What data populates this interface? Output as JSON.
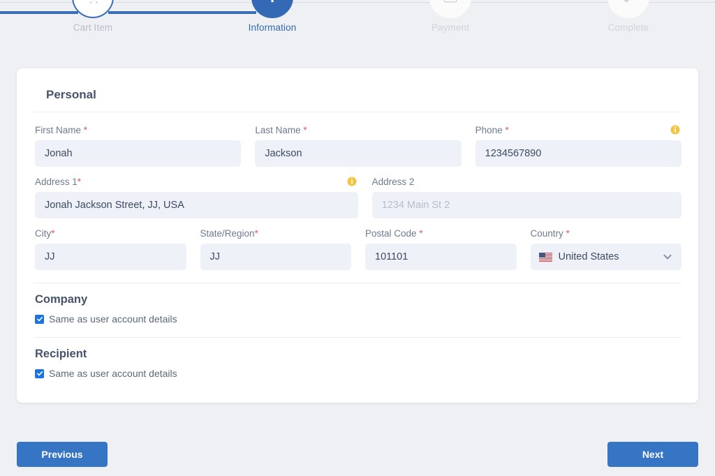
{
  "stepper": {
    "steps": [
      {
        "label": "Cart Item",
        "icon": "shopping-cart-icon",
        "state": "done"
      },
      {
        "label": "Information",
        "icon": "info-icon",
        "state": "active"
      },
      {
        "label": "Payment",
        "icon": "credit-card-icon",
        "state": "todo"
      },
      {
        "label": "Complete",
        "icon": "check-icon",
        "state": "todo"
      }
    ],
    "active_color": "#3369b5",
    "track_color": "#3a6fb8"
  },
  "card": {
    "section_title": "Personal",
    "fields": {
      "first_name": {
        "label": "First Name ",
        "required": "*",
        "value": "Jonah",
        "placeholder": ""
      },
      "last_name": {
        "label": "Last Name ",
        "required": "*",
        "value": "Jackson",
        "placeholder": ""
      },
      "phone": {
        "label": "Phone ",
        "required": "*",
        "value": "1234567890",
        "placeholder": "",
        "info": true
      },
      "address1": {
        "label": "Address 1",
        "required": "*",
        "value": "Jonah Jackson Street, JJ, USA",
        "placeholder": "",
        "info": true
      },
      "address2": {
        "label": "Address 2",
        "required": "",
        "value": "",
        "placeholder": "1234 Main St 2"
      },
      "city": {
        "label": "City",
        "required": "*",
        "value": "JJ",
        "placeholder": ""
      },
      "state": {
        "label": "State/Region",
        "required": "*",
        "value": "JJ",
        "placeholder": ""
      },
      "postal_code": {
        "label": "Postal Code ",
        "required": "*",
        "value": "101101",
        "placeholder": ""
      },
      "country": {
        "label": "Country ",
        "required": "*",
        "value": "United States",
        "flag": "us-flag-icon"
      }
    },
    "company": {
      "title": "Company",
      "checkbox_label": "Same as user account details",
      "checked": true
    },
    "recipient": {
      "title": "Recipient",
      "checkbox_label": "Same as user account details",
      "checked": true
    }
  },
  "footer": {
    "previous_label": "Previous",
    "next_label": "Next",
    "button_color": "#3675c4"
  }
}
